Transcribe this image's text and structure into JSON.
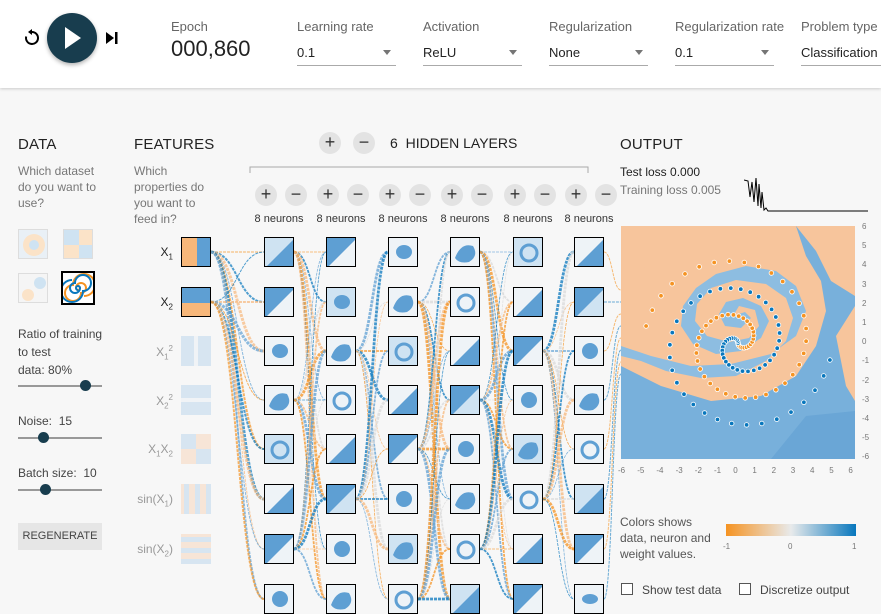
{
  "toolbar": {
    "epoch_label": "Epoch",
    "epoch_value": "000,860",
    "learning_rate_label": "Learning rate",
    "learning_rate_value": "0.1",
    "activation_label": "Activation",
    "activation_value": "ReLU",
    "regularization_label": "Regularization",
    "regularization_value": "None",
    "reg_rate_label": "Regularization rate",
    "reg_rate_value": "0.1",
    "problem_type_label": "Problem type",
    "problem_type_value": "Classification"
  },
  "data_panel": {
    "title": "DATA",
    "question": "Which dataset do you want to use?",
    "ratio_label": "Ratio of training to test data:",
    "ratio_value": "80%",
    "ratio_level": 0.8,
    "noise_label": "Noise:",
    "noise_value": "15",
    "noise_level": 0.3,
    "batch_label": "Batch size:",
    "batch_value": "10",
    "batch_level": 0.32,
    "regenerate": "REGENERATE",
    "selected_dataset": "spiral"
  },
  "features_panel": {
    "title": "FEATURES",
    "question": "Which properties do you want to feed in?",
    "features": [
      {
        "label": "X",
        "sub": "1",
        "sup": "",
        "active": true
      },
      {
        "label": "X",
        "sub": "2",
        "sup": "",
        "active": true
      },
      {
        "label": "X",
        "sub": "1",
        "sup": "2",
        "active": false
      },
      {
        "label": "X",
        "sub": "2",
        "sup": "2",
        "active": false
      },
      {
        "label": "X",
        "sub": "1",
        "label2": "X",
        "sub2": "2",
        "active": false
      },
      {
        "label": "sin(X",
        "sub": "1",
        "tail": ")",
        "active": false
      },
      {
        "label": "sin(X",
        "sub": "2",
        "tail": ")",
        "active": false
      }
    ]
  },
  "network": {
    "layer_count": "6",
    "hidden_layers_label": "HIDDEN LAYERS",
    "plus": "+",
    "minus": "−",
    "layers": [
      {
        "neurons_label": "8 neurons"
      },
      {
        "neurons_label": "8 neurons"
      },
      {
        "neurons_label": "8 neurons"
      },
      {
        "neurons_label": "8 neurons"
      },
      {
        "neurons_label": "8 neurons"
      },
      {
        "neurons_label": "8 neurons"
      }
    ]
  },
  "output_panel": {
    "title": "OUTPUT",
    "test_loss_label": "Test loss",
    "test_loss_value": "0.000",
    "training_loss_label": "Training loss",
    "training_loss_value": "0.005",
    "y_ticks": [
      "6",
      "5",
      "4",
      "3",
      "2",
      "1",
      "0",
      "-1",
      "-2",
      "-3",
      "-4",
      "-5",
      "-6"
    ],
    "x_ticks": [
      "-6",
      "-5",
      "-4",
      "-3",
      "-2",
      "-1",
      "0",
      "1",
      "2",
      "3",
      "4",
      "5",
      "6"
    ],
    "legend_text": "Colors shows data, neuron and weight values.",
    "legend_min": "-1",
    "legend_mid": "0",
    "legend_max": "1",
    "show_test_label": "Show test data",
    "discretize_label": "Discretize output"
  },
  "colors": {
    "orange": "#f59322",
    "blue": "#0877bd",
    "dark_blue": "#183d4e"
  }
}
